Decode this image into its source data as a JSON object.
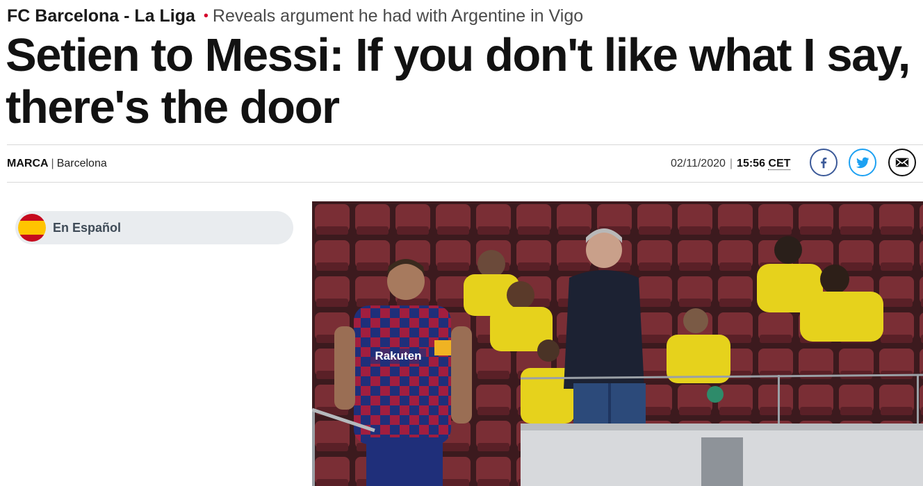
{
  "header": {
    "section": "FC Barcelona - La Liga",
    "bullet": "•",
    "subtitle": "Reveals argument he had with Argentine in Vigo"
  },
  "headline": "Setien to Messi: If you don't like what I say, there's the door",
  "byline": {
    "source": "MARCA",
    "separator": "|",
    "location": "Barcelona"
  },
  "dateline": {
    "date": "02/11/2020",
    "separator": "|",
    "time": "15:56",
    "timezone": "CET"
  },
  "share": {
    "facebook_icon": "facebook-icon",
    "twitter_icon": "twitter-icon",
    "email_icon": "email-icon"
  },
  "language_switch": {
    "label": "En Español",
    "flag_icon": "spain-flag-icon"
  },
  "photo": {
    "jersey_sponsor": "Rakuten",
    "colors": {
      "seats": "#7a2e35",
      "bib": "#f2e31a",
      "jersey_blue": "#1f2f7a",
      "jersey_red": "#a11e3f"
    }
  },
  "colors": {
    "accent_red": "#d5002b",
    "facebook": "#3b5998",
    "twitter": "#1da1f2",
    "pill_bg": "#e9ecef"
  }
}
